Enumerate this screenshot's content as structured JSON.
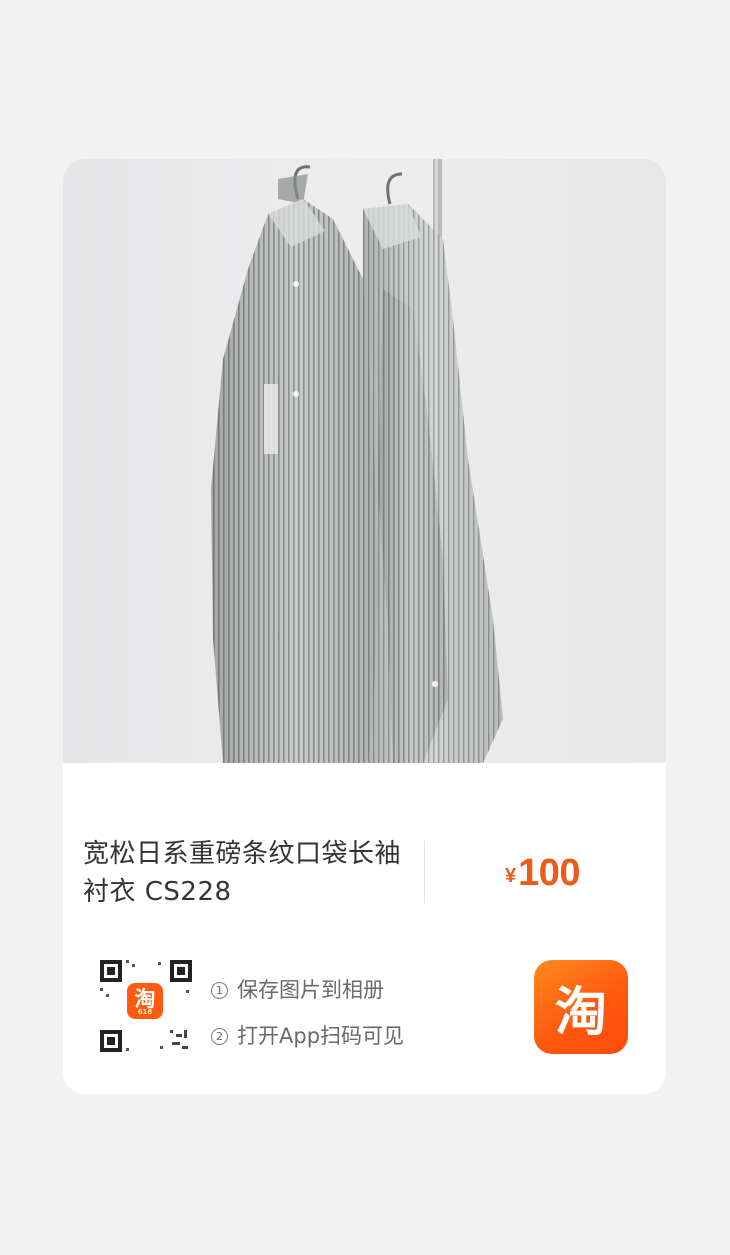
{
  "product": {
    "title": "宽松日系重磅条纹口袋长袖衬衣 CS228",
    "currency_symbol": "¥",
    "price": "100",
    "image_alt": "two grey striped shirts hanging on a rack"
  },
  "share": {
    "step1_num": "1",
    "step1": "保存图片到相册",
    "step2_num": "2",
    "step2": "打开App扫码可见",
    "qr_logo_text": "淘",
    "qr_logo_badge": "618",
    "app_logo_text": "淘"
  },
  "colors": {
    "price": "#f05a18",
    "app_logo": "#ff5a10",
    "background": "#f2f2f2",
    "card": "#ffffff"
  },
  "icons": [
    "qr-code-icon",
    "taobao-logo-icon"
  ]
}
